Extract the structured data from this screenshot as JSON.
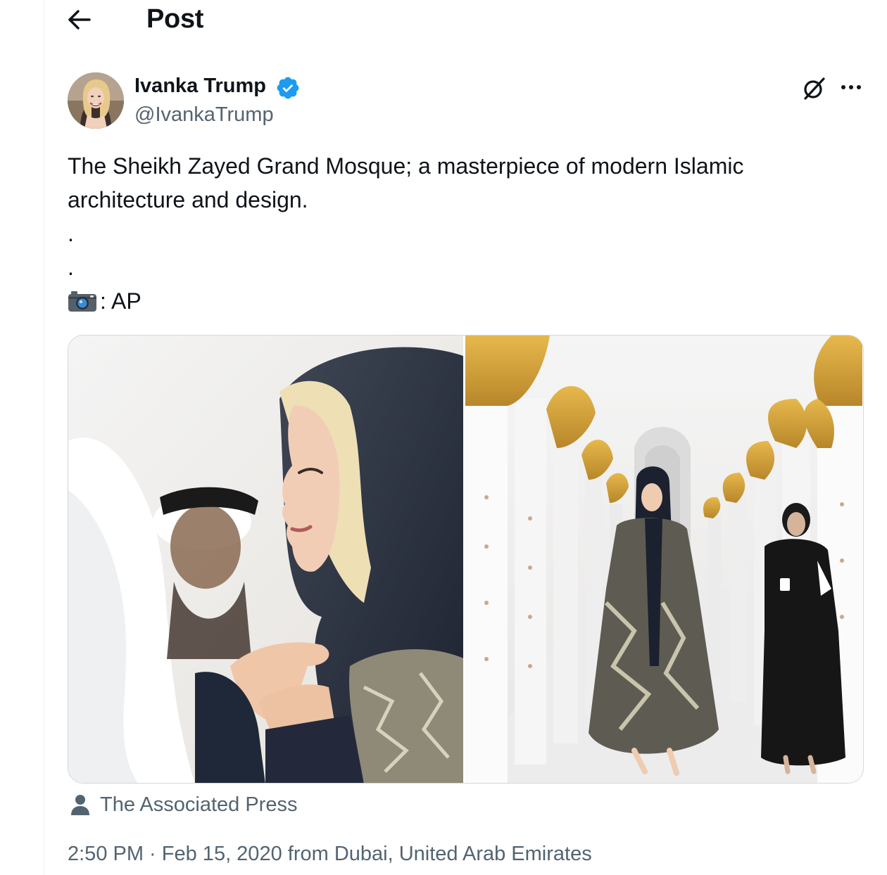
{
  "header": {
    "title": "Post",
    "back_icon": "arrow-left-icon"
  },
  "author": {
    "name": "Ivanka Trump",
    "handle": "@IvankaTrump",
    "verified": true,
    "badge_color": "#1d9bf0"
  },
  "tweet": {
    "line1": "The Sheikh Zayed Grand Mosque; a masterpiece of modern Islamic",
    "line2": "architecture and design.",
    "dot1": ".",
    "dot2": ".",
    "credit_emoji": "camera-icon",
    "credit_text": ": AP"
  },
  "media": {
    "count": 2,
    "attribution": "The Associated Press"
  },
  "meta": {
    "time": "2:50 PM",
    "separator": " · ",
    "date": "Feb 15, 2020",
    "location": " from Dubai, United Arab Emirates"
  },
  "colors": {
    "text_primary": "#0f1419",
    "text_secondary": "#536471",
    "accent": "#1d9bf0"
  }
}
